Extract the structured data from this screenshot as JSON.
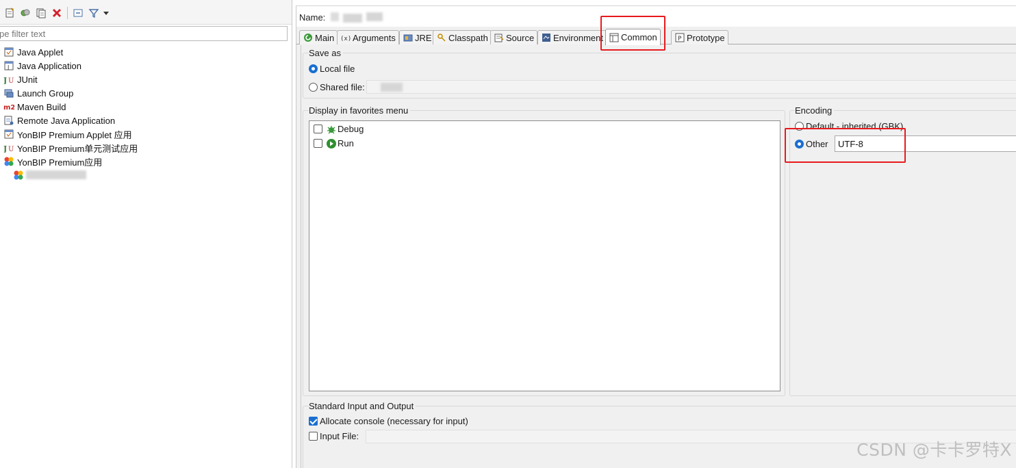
{
  "left_pane": {
    "toolbar": {
      "icons": [
        "new-launch-config-icon",
        "duplicate-icon",
        "export-icon",
        "delete-icon",
        "collapse-all-icon",
        "filter-icon",
        "dropdown-arrow-icon"
      ]
    },
    "filter_placeholder": "pe filter text",
    "tree_items": [
      {
        "label": "Java Applet",
        "icon": "java-applet-icon"
      },
      {
        "label": "Java Application",
        "icon": "java-application-icon"
      },
      {
        "label": "JUnit",
        "icon": "junit-icon"
      },
      {
        "label": "Launch Group",
        "icon": "launch-group-icon"
      },
      {
        "label": "Maven Build",
        "icon": "maven-icon"
      },
      {
        "label": "Remote Java Application",
        "icon": "remote-java-icon"
      },
      {
        "label": "YonBIP Premium Applet 应用",
        "icon": "yonbip-applet-icon"
      },
      {
        "label": "YonBIP Premium单元测试应用",
        "icon": "yonbip-unit-test-icon"
      },
      {
        "label": "YonBIP Premium应用",
        "icon": "yonbip-app-icon"
      }
    ]
  },
  "right_pane": {
    "name_label": "Name:",
    "tabs": [
      {
        "label": "Main",
        "icon": "main-tab-icon"
      },
      {
        "label": "Arguments",
        "icon": "arguments-icon"
      },
      {
        "label": "JRE",
        "icon": "jre-icon"
      },
      {
        "label": "Classpath",
        "icon": "classpath-icon"
      },
      {
        "label": "Source",
        "icon": "source-icon"
      },
      {
        "label": "Environment",
        "icon": "environment-icon"
      },
      {
        "label": "Common",
        "icon": "common-icon",
        "active": true
      },
      {
        "label": "Prototype",
        "icon": "prototype-icon"
      }
    ],
    "save_as": {
      "title": "Save as",
      "local_file_label": "Local file",
      "local_file_selected": true,
      "shared_file_label": "Shared file:",
      "shared_file_selected": false
    },
    "favorites": {
      "title": "Display in favorites menu",
      "items": [
        {
          "label": "Debug",
          "checked": false,
          "icon": "debug-bug-icon"
        },
        {
          "label": "Run",
          "checked": false,
          "icon": "run-play-icon"
        }
      ]
    },
    "encoding": {
      "title": "Encoding",
      "default_label": "Default - inherited (GBK)",
      "default_selected": false,
      "other_label": "Other",
      "other_selected": true,
      "other_value": "UTF-8"
    },
    "std_io": {
      "title": "Standard Input and Output",
      "allocate_console_label": "Allocate console (necessary for input)",
      "allocate_console_checked": true,
      "input_file_label": "Input File:",
      "input_file_checked": false
    }
  },
  "annotations": {
    "highlight_color": "#e8191c"
  },
  "watermark": "CSDN @卡卡罗特X",
  "colors": {
    "accent": "#1a6fd1",
    "panel_bg": "#f0f0f0"
  }
}
